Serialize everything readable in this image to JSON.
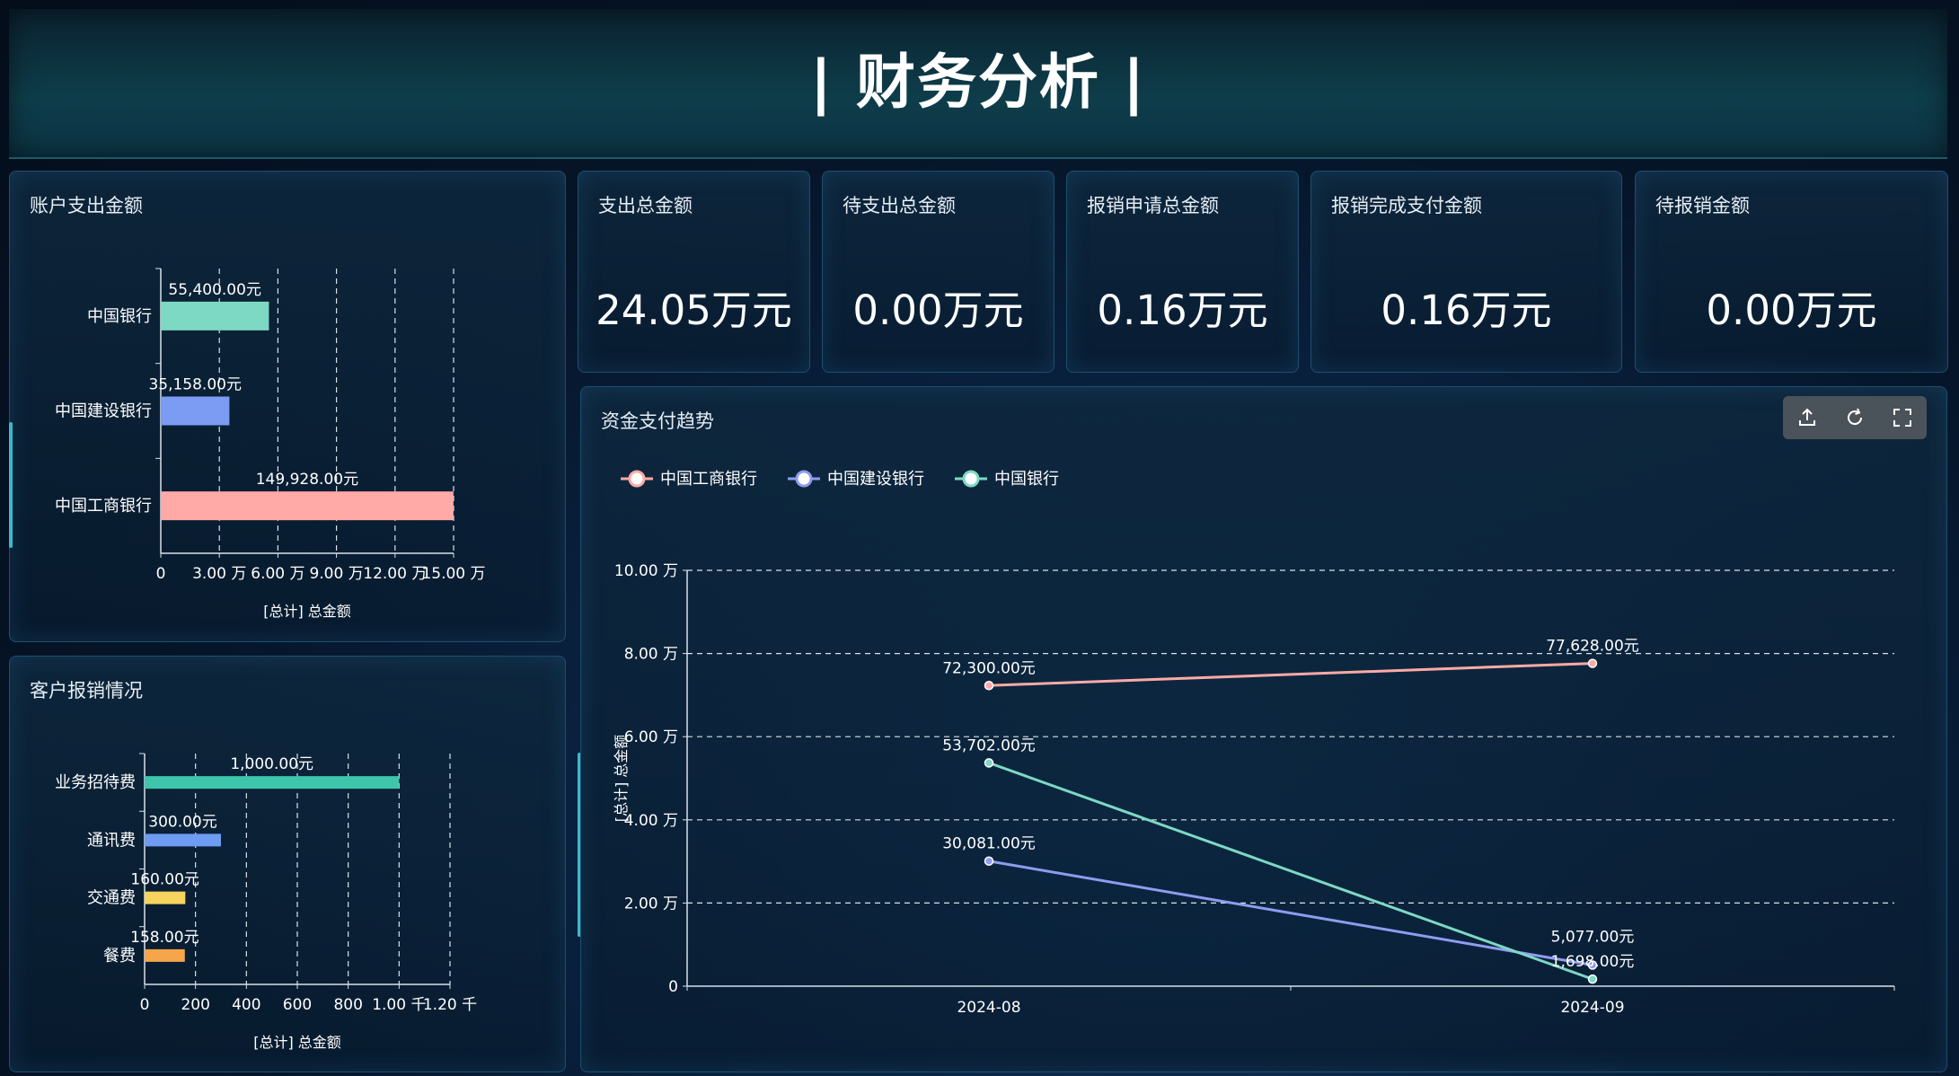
{
  "header": {
    "title": "| 财务分析 |"
  },
  "panels": {
    "account": {
      "title": "账户支出金额"
    },
    "customer": {
      "title": "客户报销情况"
    },
    "trend": {
      "title": "资金支付趋势"
    }
  },
  "kpis": [
    {
      "label": "支出总金额",
      "value": "24.05万元"
    },
    {
      "label": "待支出总金额",
      "value": "0.00万元"
    },
    {
      "label": "报销申请总金额",
      "value": "0.16万元"
    },
    {
      "label": "报销完成支付金额",
      "value": "0.16万元"
    },
    {
      "label": "待报销金额",
      "value": "0.00万元"
    }
  ],
  "toolbox": [
    {
      "name": "export-icon"
    },
    {
      "name": "refresh-icon"
    },
    {
      "name": "fullscreen-icon"
    }
  ],
  "chart_data": [
    {
      "type": "bar",
      "orientation": "horizontal",
      "categories": [
        "中国银行",
        "中国建设银行",
        "中国工商银行"
      ],
      "values": [
        55400,
        35158,
        149928
      ],
      "data_labels": [
        "55,400.00元",
        "35,158.00元",
        "149,928.00元"
      ],
      "colors": [
        "#7dd9c3",
        "#7b9cf2",
        "#ffaaa6"
      ],
      "xlabel": "[总计] 总金额",
      "xlim": [
        0,
        150000
      ],
      "xticks": [
        0,
        30000,
        60000,
        90000,
        120000,
        150000
      ],
      "xtick_labels": [
        "0",
        "3.00 万",
        "6.00 万",
        "9.00 万",
        "12.00 万",
        "15.00 万"
      ],
      "grid": true
    },
    {
      "type": "bar",
      "orientation": "horizontal",
      "categories": [
        "业务招待费",
        "通讯费",
        "交通费",
        "餐费"
      ],
      "values": [
        1000,
        300,
        160,
        158
      ],
      "data_labels": [
        "1,000.00元",
        "300.00元",
        "160.00元",
        "158.00元"
      ],
      "colors": [
        "#3ec6ac",
        "#6d9cf2",
        "#f5d35c",
        "#f7a54a"
      ],
      "xlabel": "[总计] 总金额",
      "xlim": [
        0,
        1200
      ],
      "xticks": [
        0,
        200,
        400,
        600,
        800,
        1000,
        1200
      ],
      "xtick_labels": [
        "0",
        "200",
        "400",
        "600",
        "800",
        "1.00 千",
        "1.20 千"
      ],
      "grid": true
    },
    {
      "type": "line",
      "x": [
        "2024-08",
        "2024-09"
      ],
      "series": [
        {
          "name": "中国工商银行",
          "color": "#ffaaa6",
          "values": [
            72300,
            77628
          ],
          "labels": [
            "72,300.00元",
            "77,628.00元"
          ]
        },
        {
          "name": "中国建设银行",
          "color": "#8f9cf0",
          "values": [
            30081,
            5077
          ],
          "labels": [
            "30,081.00元",
            "5,077.00元"
          ]
        },
        {
          "name": "中国银行",
          "color": "#7dd9c3",
          "values": [
            53702,
            1698
          ],
          "labels": [
            "53,702.00元",
            "1,698.00元"
          ]
        }
      ],
      "ylabel": "[总计] 总金额",
      "ylim": [
        0,
        100000
      ],
      "yticks": [
        0,
        20000,
        40000,
        60000,
        80000,
        100000
      ],
      "ytick_labels": [
        "0",
        "2.00 万",
        "4.00 万",
        "6.00 万",
        "8.00 万",
        "10.00 万"
      ],
      "legend_position": "top-left",
      "grid": true
    }
  ]
}
